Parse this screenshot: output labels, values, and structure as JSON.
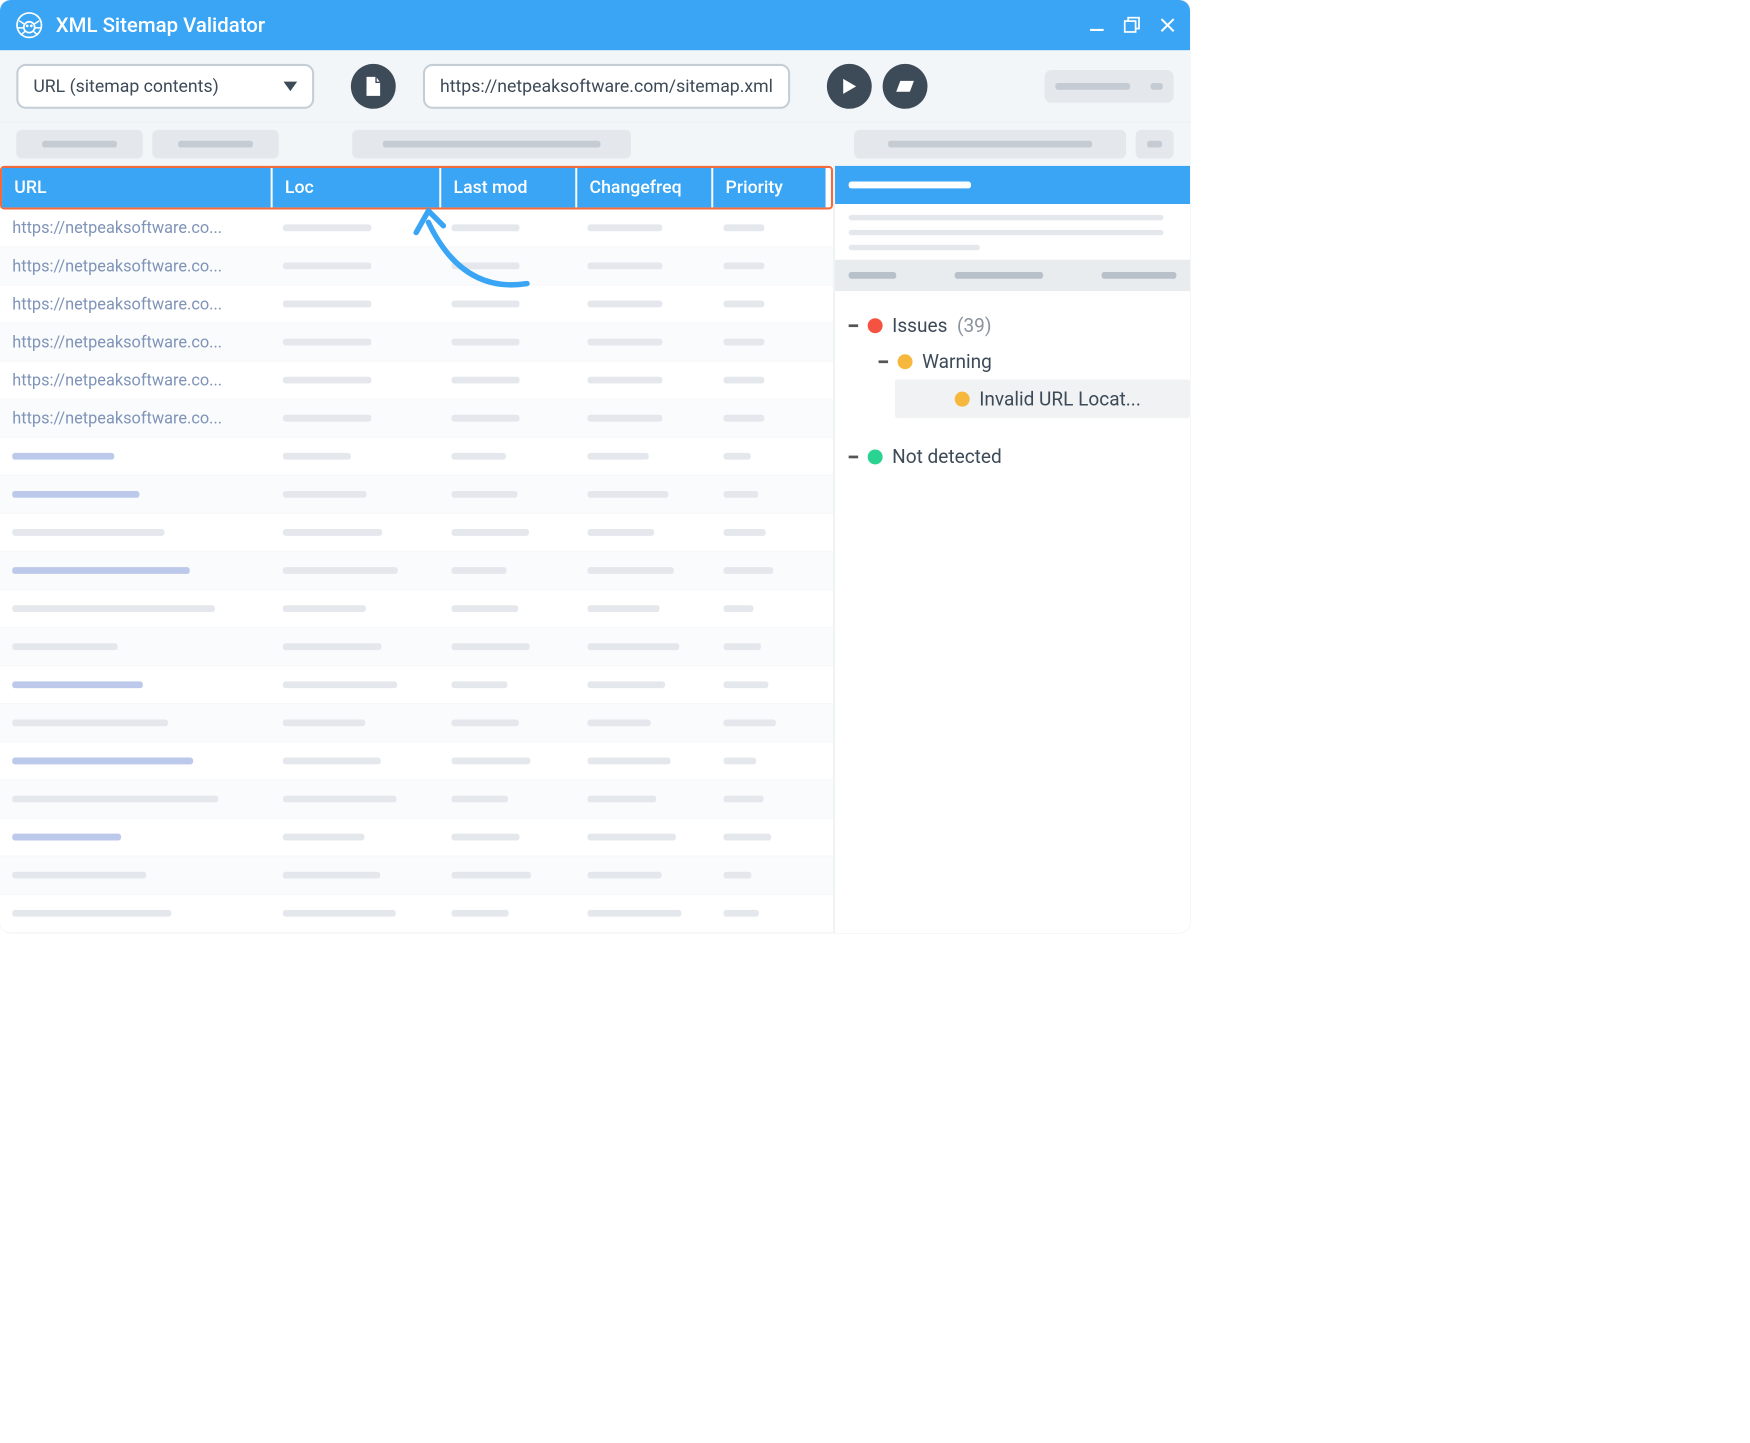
{
  "window": {
    "title": "XML Sitemap Validator"
  },
  "toolbar": {
    "mode_label": "URL (sitemap contents)",
    "url_value": "https://netpeaksoftware.com/sitemap.xml"
  },
  "table": {
    "columns": [
      "URL",
      "Loc",
      "Last mod",
      "Changefreq",
      "Priority"
    ],
    "rows": [
      {
        "url": "https://netpeaksoftware.co..."
      },
      {
        "url": "https://netpeaksoftware.co..."
      },
      {
        "url": "https://netpeaksoftware.co..."
      },
      {
        "url": "https://netpeaksoftware.co..."
      },
      {
        "url": "https://netpeaksoftware.co..."
      },
      {
        "url": "https://netpeaksoftware.co..."
      }
    ],
    "placeholder_rows": 13
  },
  "issues_panel": {
    "issues_label": "Issues",
    "issues_count": "(39)",
    "warning_label": "Warning",
    "invalid_url_label": "Invalid URL Locat...",
    "not_detected_label": "Not detected"
  }
}
